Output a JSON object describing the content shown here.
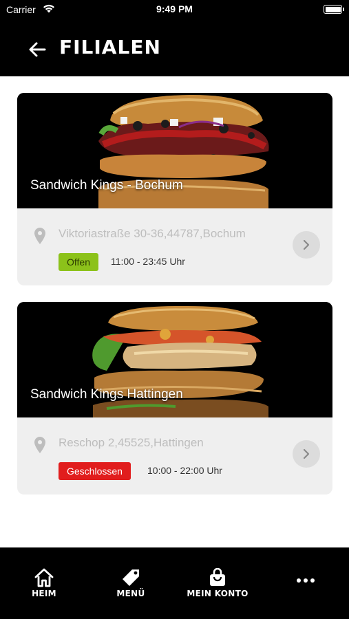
{
  "status_bar": {
    "carrier": "Carrier",
    "time": "9:49 PM"
  },
  "header": {
    "title": "FILIALEN",
    "back_icon": "arrow-left-icon"
  },
  "branches": [
    {
      "name": "Sandwich Kings - Bochum",
      "address": "Viktoriastraße 30-36,44787,Bochum",
      "status": "Offen",
      "status_color": "#8cc21a",
      "hours": "11:00 - 23:45 Uhr"
    },
    {
      "name": "Sandwich Kings Hattingen",
      "address": "Reschop 2,45525,Hattingen",
      "status": "Geschlossen",
      "status_color": "#e11d1d",
      "hours": "10:00 - 22:00 Uhr"
    }
  ],
  "tabs": [
    {
      "label": "HEIM",
      "icon": "home-icon"
    },
    {
      "label": "MENÜ",
      "icon": "tag-icon"
    },
    {
      "label": "MEIN KONTO",
      "icon": "shopping-bag-icon"
    },
    {
      "label": "",
      "icon": "more-dots-icon"
    }
  ]
}
